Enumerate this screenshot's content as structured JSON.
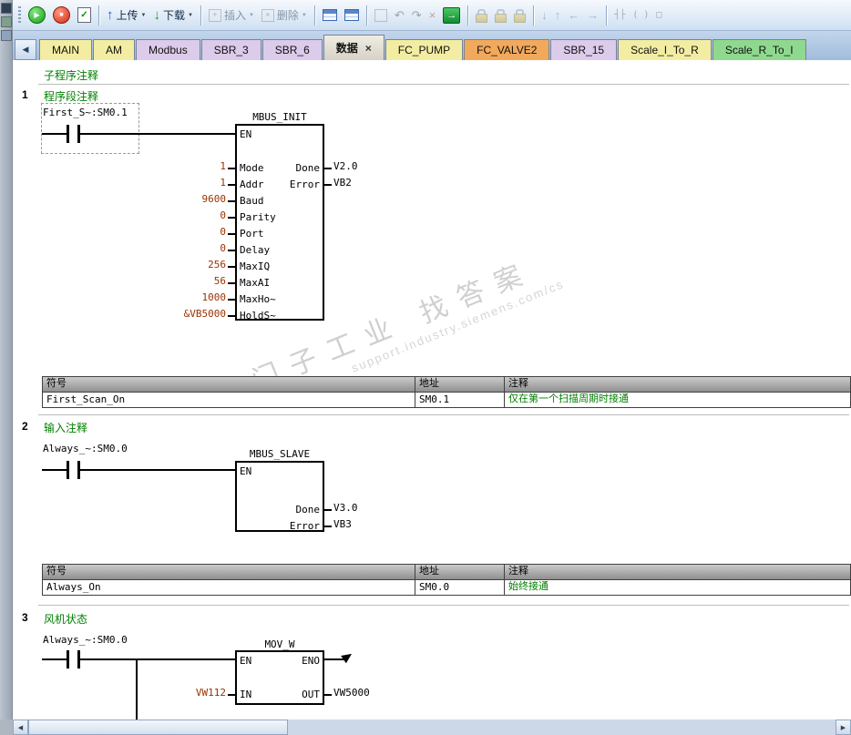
{
  "theme": {
    "comment_green": "#008000",
    "constant_red": "#993300",
    "tab_yellow": "#f3eda3",
    "tab_lavender": "#dccbea",
    "tab_orange": "#f2a95c",
    "tab_green": "#8fd98f",
    "tab_active": "#d8d4ca"
  },
  "icons": {
    "run": "▶",
    "stop": "■",
    "compile": "✓",
    "upload_arrow": "↑",
    "download_arrow": "↓",
    "caret": "▼",
    "back": "◀",
    "plus": "+",
    "cross": "×",
    "undo": "↶",
    "redo": "↷",
    "go_arrow": "→",
    "wire_down": "↓",
    "wire_up": "↑",
    "wire_left": "←",
    "wire_right": "→",
    "contact_tool": "┤├",
    "coil_tool": "( )",
    "box_tool": "□",
    "scroll_left": "◀",
    "scroll_right": "▶"
  },
  "toolbar": {
    "upload": "上传",
    "download": "下载",
    "insert": "插入",
    "delete": "删除"
  },
  "tabs": {
    "close_glyph": "×",
    "items": [
      {
        "label": "MAIN",
        "color": "#f3eda3"
      },
      {
        "label": "AM",
        "color": "#f3eda3"
      },
      {
        "label": "Modbus",
        "color": "#dccbea"
      },
      {
        "label": "SBR_3",
        "color": "#dccbea"
      },
      {
        "label": "SBR_6",
        "color": "#dccbea"
      },
      {
        "label": "数据",
        "color": "#d8d4ca",
        "active": true
      },
      {
        "label": "FC_PUMP",
        "color": "#f3eda3"
      },
      {
        "label": "FC_VALVE2",
        "color": "#f2a95c"
      },
      {
        "label": "SBR_15",
        "color": "#dccbea"
      },
      {
        "label": "Scale_I_To_R",
        "color": "#f3eda3"
      },
      {
        "label": "Scale_R_To_I",
        "color": "#8fd98f"
      }
    ]
  },
  "editor": {
    "program_comment": "子程序注释",
    "watermark_line1": "西门子工业 找答案",
    "watermark_line2": "support.industry.siemens.com/cs"
  },
  "network1": {
    "number": "1",
    "comment": "程序段注释",
    "contact": "First_S~:SM0.1",
    "block": "MBUS_INIT",
    "en": "EN",
    "pins": [
      {
        "v": "1",
        "p": "Mode"
      },
      {
        "v": "1",
        "p": "Addr"
      },
      {
        "v": "9600",
        "p": "Baud"
      },
      {
        "v": "0",
        "p": "Parity"
      },
      {
        "v": "0",
        "p": "Port"
      },
      {
        "v": "0",
        "p": "Delay"
      },
      {
        "v": "256",
        "p": "MaxIQ"
      },
      {
        "v": "56",
        "p": "MaxAI"
      },
      {
        "v": "1000",
        "p": "MaxHo~"
      },
      {
        "v": "&VB5000",
        "p": "HoldS~"
      }
    ],
    "out1p": "Done",
    "out1v": "V2.0",
    "out2p": "Error",
    "out2v": "VB2",
    "th_symbol": "符号",
    "th_addr": "地址",
    "th_comment": "注释",
    "row_symbol": "First_Scan_On",
    "row_addr": "SM0.1",
    "row_comment": "仅在第一个扫描周期时接通"
  },
  "network2": {
    "number": "2",
    "comment": "输入注释",
    "contact": "Always_~:SM0.0",
    "block": "MBUS_SLAVE",
    "en": "EN",
    "out1p": "Done",
    "out1v": "V3.0",
    "out2p": "Error",
    "out2v": "VB3",
    "th_symbol": "符号",
    "th_addr": "地址",
    "th_comment": "注释",
    "row_symbol": "Always_On",
    "row_addr": "SM0.0",
    "row_comment": "始终接通"
  },
  "network3": {
    "number": "3",
    "comment": "风机状态",
    "contact": "Always_~:SM0.0",
    "block": "MOV_W",
    "en": "EN",
    "eno": "ENO",
    "in_p": "IN",
    "in_v": "VW112",
    "out_p": "OUT",
    "out_v": "VW5000"
  }
}
